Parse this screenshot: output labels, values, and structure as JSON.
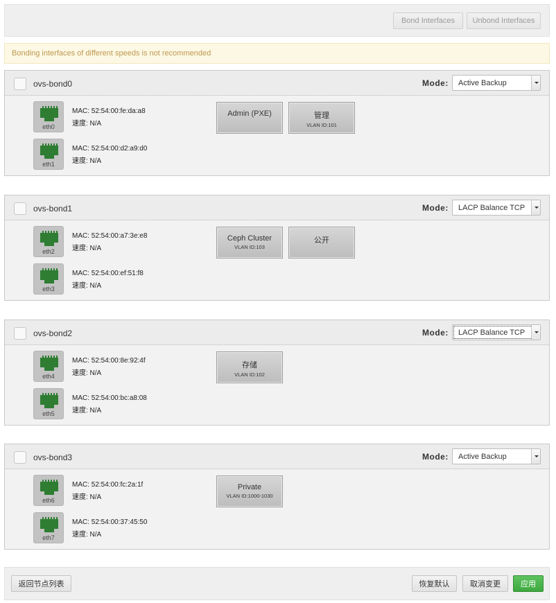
{
  "toolbar": {
    "bond_label": "Bond Interfaces",
    "unbond_label": "Unbond Interfaces"
  },
  "warning": "Bonding interfaces of different speeds is not recommended",
  "mode_label": "Mode:",
  "speed_prefix_note": "速度: N/A",
  "bonds": [
    {
      "name": "ovs-bond0",
      "mode": "Active Backup",
      "interfaces": [
        {
          "name": "eth0",
          "mac": "MAC: 52:54:00:fe:da:a8",
          "speed": "速度: N/A"
        },
        {
          "name": "eth1",
          "mac": "MAC: 52:54:00:d2:a9:d0",
          "speed": "速度: N/A"
        }
      ],
      "networks": [
        {
          "name": "Admin (PXE)",
          "vlan": ""
        },
        {
          "name": "管理",
          "vlan": "VLAN ID:101"
        }
      ]
    },
    {
      "name": "ovs-bond1",
      "mode": "LACP Balance TCP",
      "interfaces": [
        {
          "name": "eth2",
          "mac": "MAC: 52:54:00:a7:3e:e8",
          "speed": "速度: N/A"
        },
        {
          "name": "eth3",
          "mac": "MAC: 52:54:00:ef:51:f8",
          "speed": "速度: N/A"
        }
      ],
      "networks": [
        {
          "name": "Ceph Cluster",
          "vlan": "VLAN ID:103"
        },
        {
          "name": "公开",
          "vlan": ""
        }
      ]
    },
    {
      "name": "ovs-bond2",
      "mode": "LACP Balance TCP",
      "interfaces": [
        {
          "name": "eth4",
          "mac": "MAC: 52:54:00:8e:92:4f",
          "speed": "速度: N/A"
        },
        {
          "name": "eth5",
          "mac": "MAC: 52:54:00:bc:a8:08",
          "speed": "速度: N/A"
        }
      ],
      "networks": [
        {
          "name": "存储",
          "vlan": "VLAN ID:102"
        }
      ]
    },
    {
      "name": "ovs-bond3",
      "mode": "Active Backup",
      "interfaces": [
        {
          "name": "eth6",
          "mac": "MAC: 52:54:00:fc:2a:1f",
          "speed": "速度: N/A"
        },
        {
          "name": "eth7",
          "mac": "MAC: 52:54:00:37:45:50",
          "speed": "速度: N/A"
        }
      ],
      "networks": [
        {
          "name": "Private",
          "vlan": "VLAN ID:1000-1030"
        }
      ]
    }
  ],
  "footer": {
    "back_label": "返回节点列表",
    "reset_label": "恢复默认",
    "cancel_label": "取消变更",
    "apply_label": "应用"
  },
  "colors": {
    "port_icon": "#2e7d32",
    "apply": "#4cae4c",
    "warning_text": "#c09853"
  }
}
